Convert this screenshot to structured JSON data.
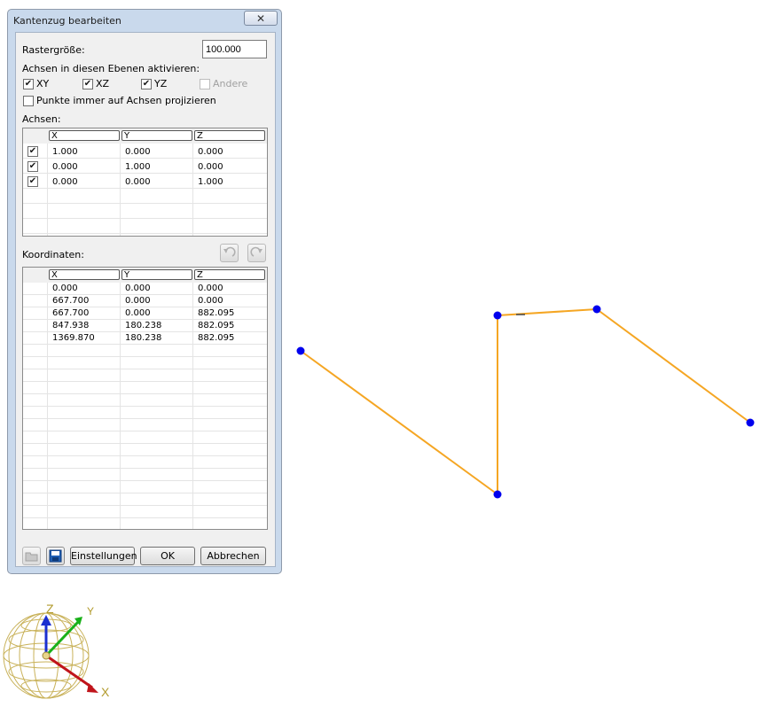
{
  "dialog": {
    "title": "Kantenzug bearbeiten",
    "close_symbol": "✕",
    "grid_size_label": "Rastergröße:",
    "grid_size_value": "100.000",
    "axes_planes_label": "Achsen in diesen Ebenen aktivieren:",
    "planes": [
      {
        "label": "XY",
        "checked": true
      },
      {
        "label": "XZ",
        "checked": true
      },
      {
        "label": "YZ",
        "checked": true
      },
      {
        "label": "Andere",
        "checked": false,
        "disabled": true
      }
    ],
    "project_label": "Punkte immer auf Achsen projizieren",
    "project_checked": false,
    "axes_label": "Achsen:",
    "axes_columns": [
      "X",
      "Y",
      "Z"
    ],
    "axes_rows": [
      {
        "checked": true,
        "x": "1.000",
        "y": "0.000",
        "z": "0.000"
      },
      {
        "checked": true,
        "x": "0.000",
        "y": "1.000",
        "z": "0.000"
      },
      {
        "checked": true,
        "x": "0.000",
        "y": "0.000",
        "z": "1.000"
      }
    ],
    "coords_label": "Koordinaten:",
    "coords_columns": [
      "X",
      "Y",
      "Z"
    ],
    "coords_rows": [
      {
        "x": "0.000",
        "y": "0.000",
        "z": "0.000"
      },
      {
        "x": "667.700",
        "y": "0.000",
        "z": "0.000"
      },
      {
        "x": "667.700",
        "y": "0.000",
        "z": "882.095"
      },
      {
        "x": "847.938",
        "y": "180.238",
        "z": "882.095"
      },
      {
        "x": "1369.870",
        "y": "180.238",
        "z": "882.095"
      }
    ],
    "buttons": {
      "settings": "Einstellungen",
      "ok": "OK",
      "cancel": "Abbrechen"
    },
    "icons": {
      "undo": "undo-icon",
      "redo": "redo-icon",
      "open": "folder-open-icon",
      "save": "floppy-save-icon"
    }
  },
  "viewport": {
    "polyline_color": "#f5a623",
    "vertex_color": "#0000ee"
  },
  "axis_gizmo": {
    "labels": {
      "x": "X",
      "y": "Y",
      "z": "Z"
    },
    "colors": {
      "x": "#c0141b",
      "y": "#19b019",
      "z": "#1b2fd0",
      "sphere": "#c9b25a"
    }
  }
}
